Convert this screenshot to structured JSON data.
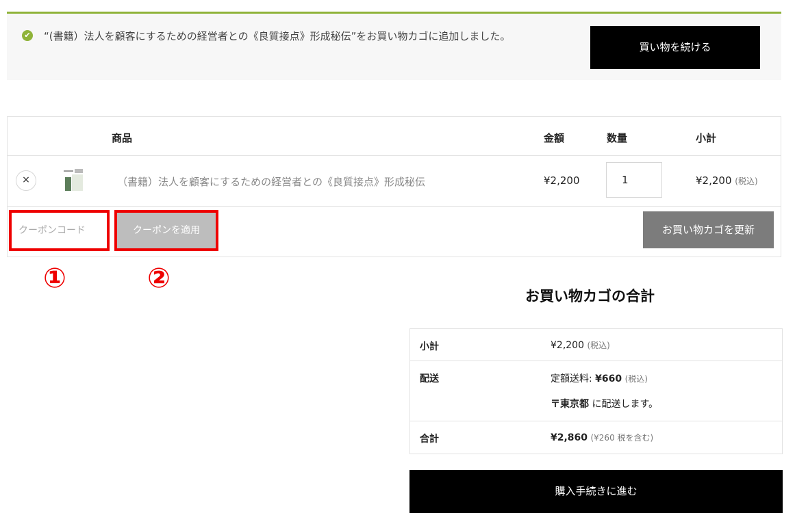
{
  "notice": {
    "message": "“(書籍）法人を顧客にするための経営者との《良質接点》形成秘伝”をお買い物カゴに追加しました。",
    "continue_label": "買い物を続ける"
  },
  "cart": {
    "headers": {
      "product": "商品",
      "price": "金額",
      "quantity": "数量",
      "subtotal": "小計"
    },
    "items": [
      {
        "remove_icon": "×",
        "name": "（書籍）法人を顧客にするための経営者との《良質接点》形成秘伝",
        "price": "¥2,200",
        "quantity": "1",
        "subtotal": "¥2,200",
        "tax_note": "(税込)"
      }
    ],
    "coupon_placeholder": "クーポンコード",
    "apply_coupon_label": "クーポンを適用",
    "update_cart_label": "お買い物カゴを更新"
  },
  "annotations": {
    "marker_1": "①",
    "marker_2": "②",
    "highlight_color": "#ee0000"
  },
  "totals": {
    "title": "お買い物カゴの合計",
    "subtotal_label": "小計",
    "subtotal_value": "¥2,200",
    "subtotal_tax": "(税込)",
    "shipping_label": "配送",
    "shipping_prefix": "定額送料: ",
    "shipping_amount": "¥660",
    "shipping_tax": "(税込)",
    "shipping_dest": "〒東京都",
    "shipping_dest_suffix": " に配送します。",
    "total_label": "合計",
    "total_value": "¥2,860",
    "total_tax": "(¥260 税を含む)"
  },
  "checkout_label": "購入手続きに進む",
  "colors": {
    "accent": "#8fb339",
    "primary_button": "#000000",
    "update_button": "#7c7c7c"
  }
}
